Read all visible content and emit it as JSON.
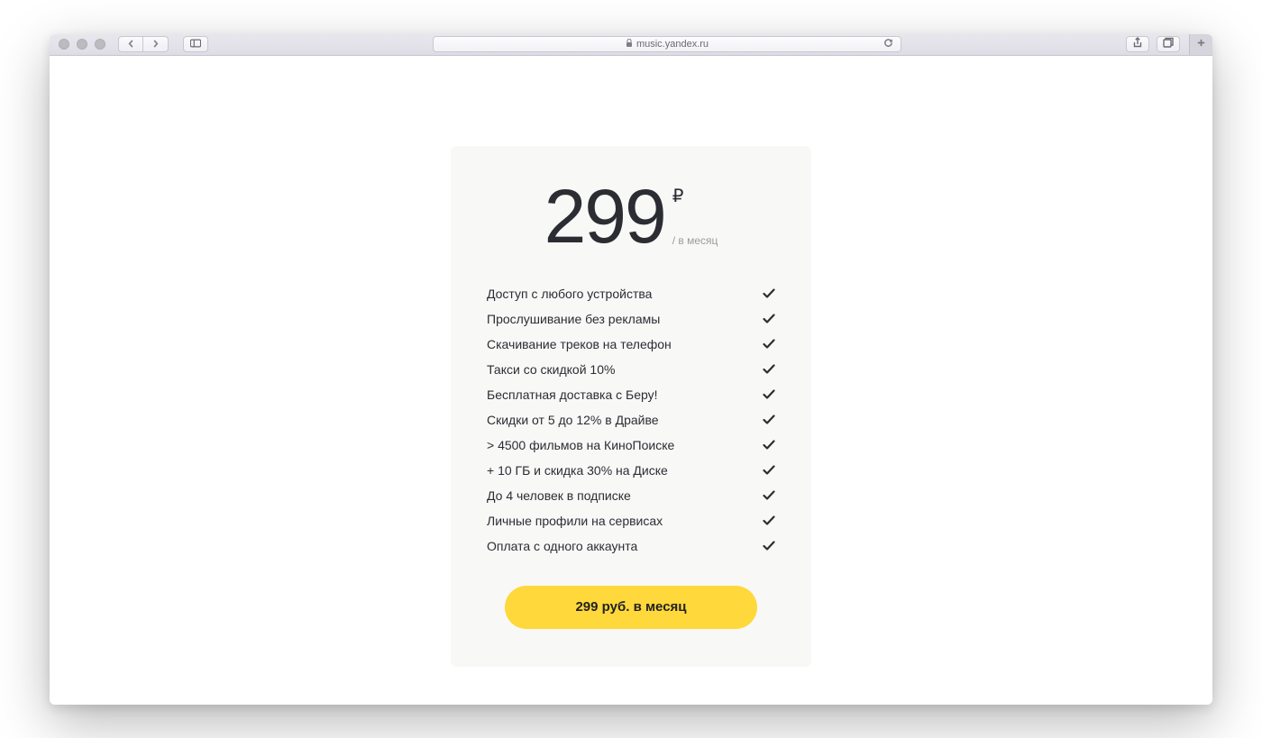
{
  "browser": {
    "url_host": "music.yandex.ru"
  },
  "pricing": {
    "price_value": "299",
    "currency_symbol": "₽",
    "period": "/ в месяц",
    "features": [
      "Доступ с любого устройства",
      "Прослушивание без рекламы",
      "Скачивание треков на телефон",
      "Такси со скидкой 10%",
      "Бесплатная доставка с Беру!",
      "Скидки от 5 до 12% в Драйве",
      "> 4500 фильмов на КиноПоиске",
      "+ 10 ГБ и скидка 30% на Диске",
      "До 4 человек в подписке",
      "Личные профили на сервисах",
      "Оплата с одного аккаунта"
    ],
    "cta_label": "299 руб. в месяц"
  }
}
